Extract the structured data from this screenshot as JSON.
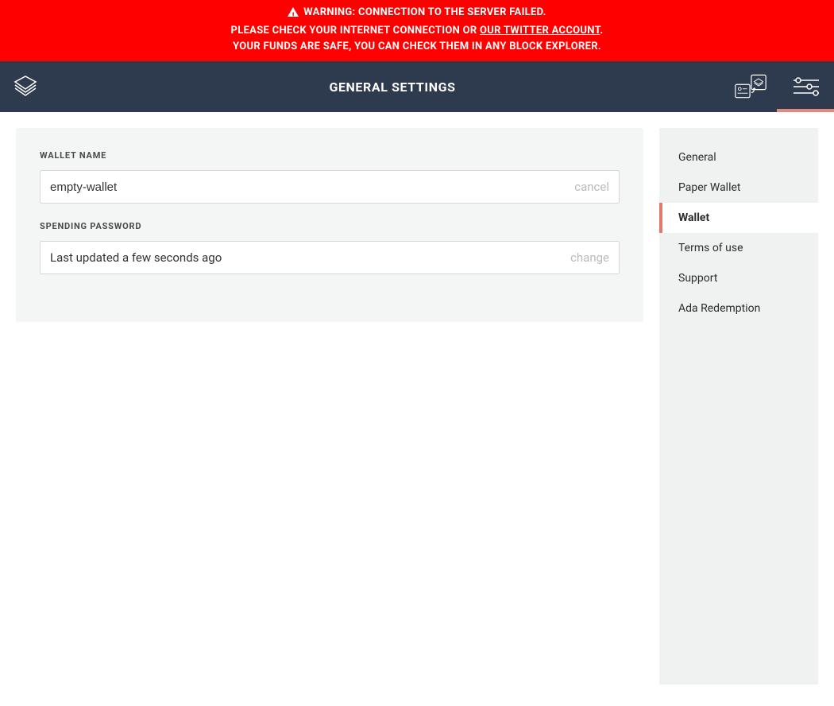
{
  "warning": {
    "line1": "WARNING: CONNECTION TO THE SERVER FAILED.",
    "line2_prefix": "PLEASE CHECK YOUR INTERNET CONNECTION OR ",
    "line2_link": "OUR TWITTER ACCOUNT",
    "line2_suffix": ".",
    "line3": "YOUR FUNDS ARE SAFE, YOU CAN CHECK THEM IN ANY BLOCK EXPLORER."
  },
  "header": {
    "title": "GENERAL SETTINGS"
  },
  "form": {
    "wallet_name_label": "WALLET NAME",
    "wallet_name_value": "empty-wallet",
    "wallet_name_action": "cancel",
    "spending_password_label": "SPENDING PASSWORD",
    "spending_password_status": "Last updated a few seconds ago",
    "spending_password_action": "change"
  },
  "sidebar": [
    {
      "label": "General",
      "active": false
    },
    {
      "label": "Paper Wallet",
      "active": false
    },
    {
      "label": "Wallet",
      "active": true
    },
    {
      "label": "Terms of use",
      "active": false
    },
    {
      "label": "Support",
      "active": false
    },
    {
      "label": "Ada Redemption",
      "active": false
    }
  ]
}
